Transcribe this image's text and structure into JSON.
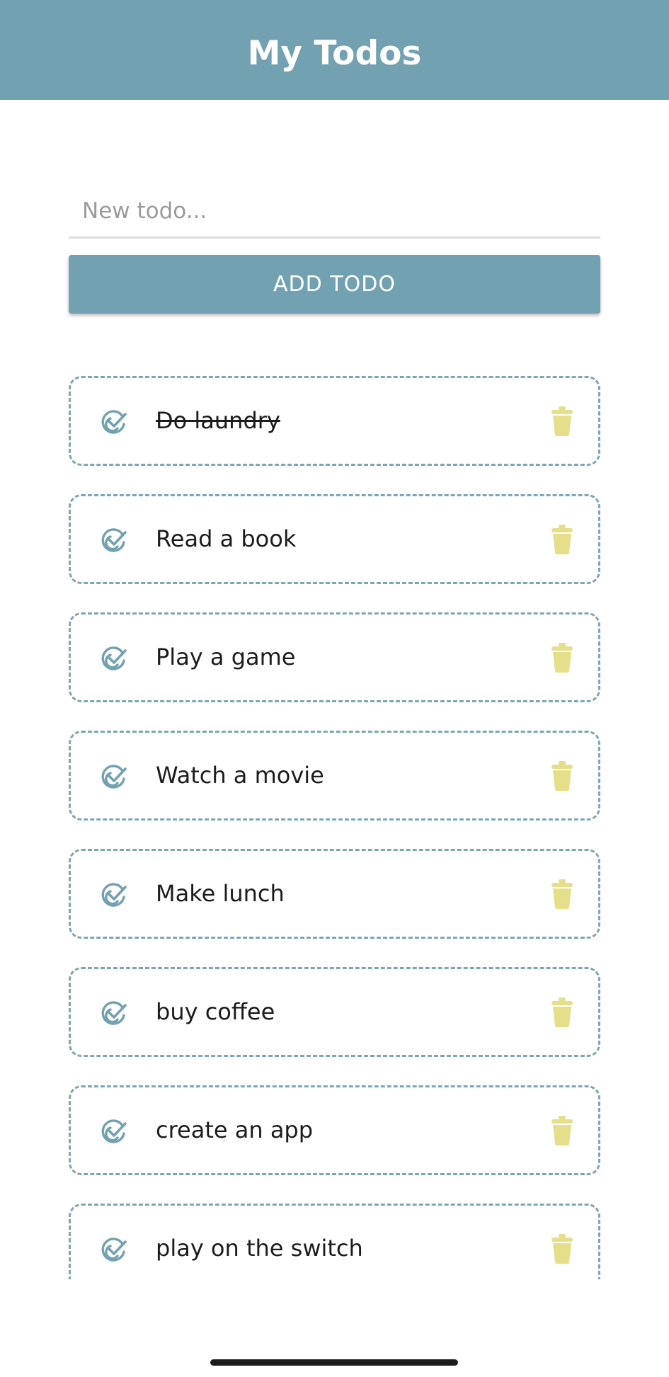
{
  "header": {
    "title": "My Todos",
    "background_color": "#72a1b1"
  },
  "new_todo": {
    "placeholder": "New todo...",
    "value": ""
  },
  "add_button": {
    "label": "ADD TODO",
    "color": "#72a1b1"
  },
  "todos": [
    {
      "text": "Do laundry",
      "completed": true
    },
    {
      "text": "Read a book",
      "completed": false
    },
    {
      "text": "Play a game",
      "completed": false
    },
    {
      "text": "Watch a movie",
      "completed": false
    },
    {
      "text": "Make lunch",
      "completed": false
    },
    {
      "text": "buy coffee",
      "completed": false
    },
    {
      "text": "create an app",
      "completed": false
    },
    {
      "text": "play on the switch",
      "completed": false
    }
  ],
  "icons": {
    "complete": "check-circle-icon",
    "delete": "trash-icon"
  },
  "colors": {
    "accent": "#72a1b1",
    "card_border": "#7ea5b3",
    "trash": "#e6df8a",
    "check": "#72a1b1"
  }
}
